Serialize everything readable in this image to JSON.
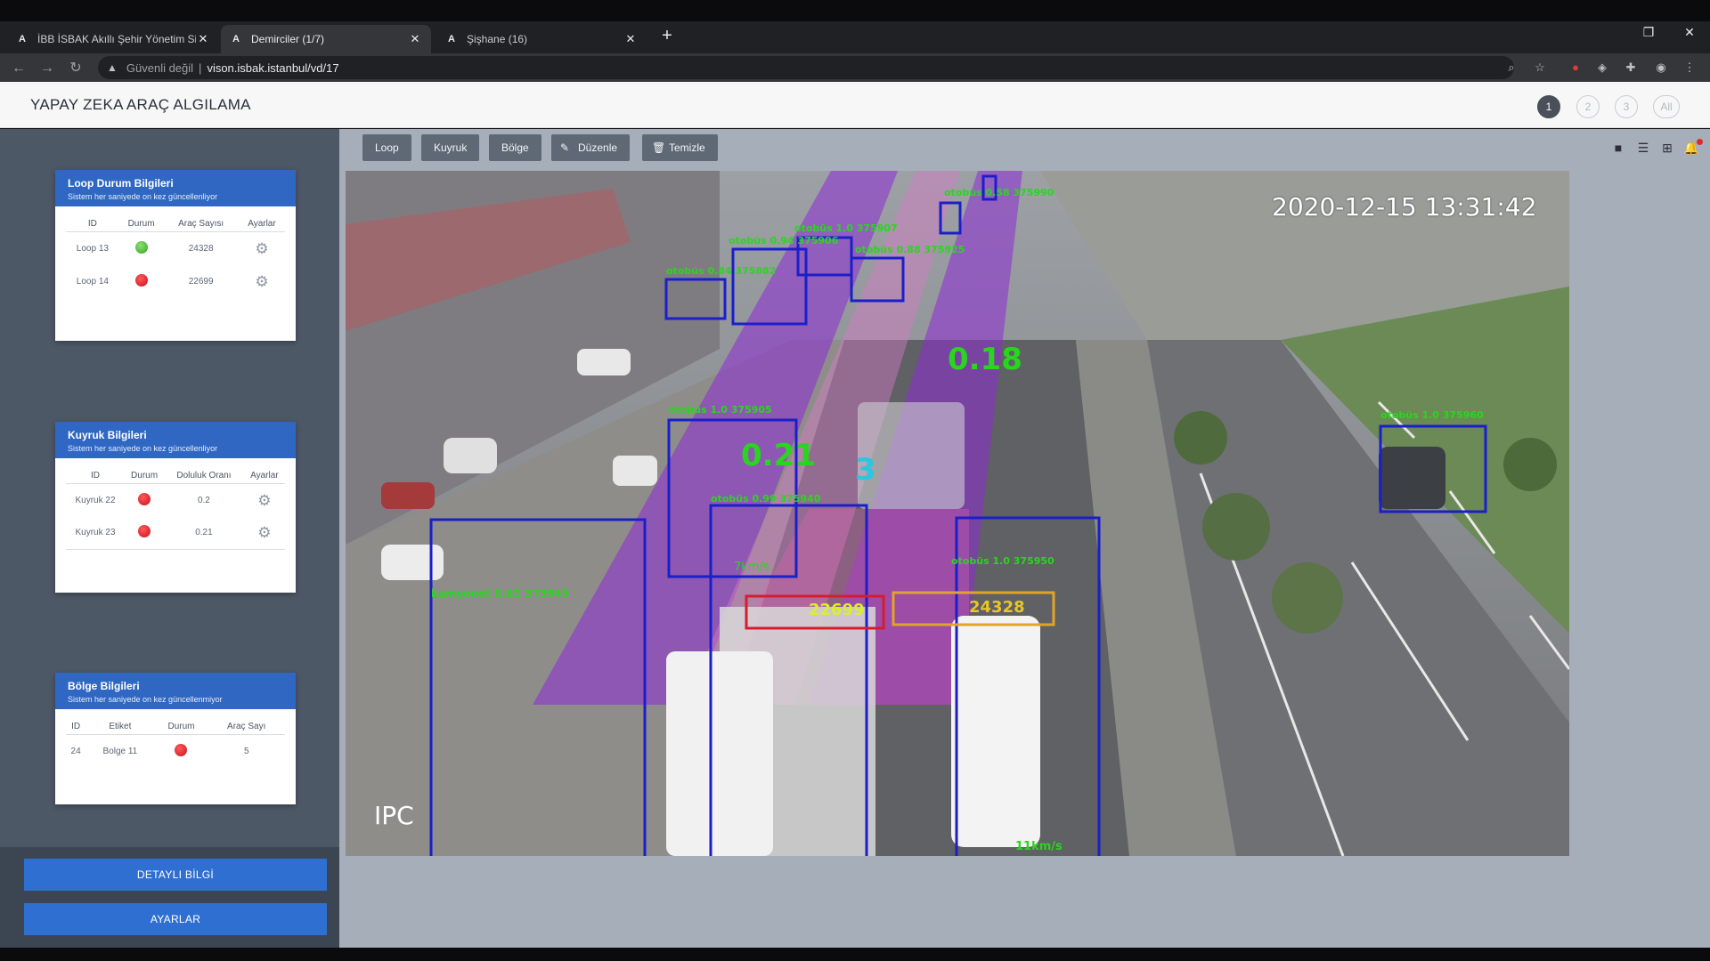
{
  "browser": {
    "tabs": [
      {
        "title": "İBB İSBAK Akıllı Şehir Yönetim Sistemi",
        "icon": "A"
      },
      {
        "title": "Demirciler (1/7)",
        "icon": "A"
      },
      {
        "title": "Şişhane (16)",
        "icon": "A"
      }
    ],
    "security_label": "Güvenli değil",
    "url": "vison.isbak.istanbul/vd/17"
  },
  "app": {
    "title": "YAPAY ZEKA ARAÇ ALGILAMA",
    "pages": [
      "1",
      "2",
      "3",
      "All"
    ]
  },
  "toolbar": {
    "loop_label": "Loop",
    "kuyruk_label": "Kuyruk",
    "bolge_label": "Bölge",
    "duzenle_label": "Düzenle",
    "temizle_label": "Temizle"
  },
  "loop_panel": {
    "title": "Loop Durum Bilgileri",
    "subtitle": "Sistem her saniyede on kez güncellenliyor",
    "headers": [
      "ID",
      "Durum",
      "Araç Sayısı",
      "Ayarlar"
    ],
    "rows": [
      {
        "id": "Loop 13",
        "status": "green",
        "count": "24328"
      },
      {
        "id": "Loop 14",
        "status": "red",
        "count": "22699"
      }
    ]
  },
  "queue_panel": {
    "title": "Kuyruk Bilgileri",
    "subtitle": "Sistem her saniyede on kez güncellenliyor",
    "headers": [
      "ID",
      "Durum",
      "Doluluk Oranı",
      "Ayarlar"
    ],
    "rows": [
      {
        "id": "Kuyruk 22",
        "status": "red",
        "ratio": "0.2"
      },
      {
        "id": "Kuyruk 23",
        "status": "red",
        "ratio": "0.21"
      }
    ]
  },
  "region_panel": {
    "title": "Bölge Bilgileri",
    "subtitle": "Sistem her saniyede on kez güncellenmiyor",
    "headers": [
      "ID",
      "Etiket",
      "Durum",
      "Araç Sayı"
    ],
    "rows": [
      {
        "id": "24",
        "label": "Bolge 11",
        "status": "red",
        "count": "5"
      }
    ]
  },
  "buttons": {
    "detail": "DETAYLI BİLGİ",
    "settings": "AYARLAR"
  },
  "video": {
    "timestamp": "2020-12-15 13:31:42",
    "camera_label": "IPC",
    "queue_value_1": "0.18",
    "queue_value_2": "0.21",
    "region_count": "3",
    "loop_count_1": "22699",
    "loop_count_2": "24328",
    "speed_1": "7km/s",
    "speed_2": "11km/s",
    "detection_1": "kamyonet 0.62 375943",
    "detection_2": "otobüs 0.84 375882",
    "detection_3": "otobüs 1.0 375907",
    "detection_4": "otobüs 0.94 375906",
    "detection_5": "otobüs 1.0 375905",
    "detection_6": "otobüs 1.0 375960",
    "detection_7": "otobüs 0.58 375990",
    "detection_8": "otobüs 0.88 375925",
    "detection_9": "otobüs 0.99 375940",
    "detection_10": "otobüs 1.0 375950"
  },
  "colors": {
    "accent": "#2f67c2",
    "sidebar": "#4d5866",
    "queue_purple": "#8e2bd6",
    "region_pink": "#e35fb4",
    "box_blue": "#1a1fc9",
    "label_green": "#29d61e",
    "loop_red": "#d61c2e",
    "loop_orange": "#e0a42a"
  }
}
